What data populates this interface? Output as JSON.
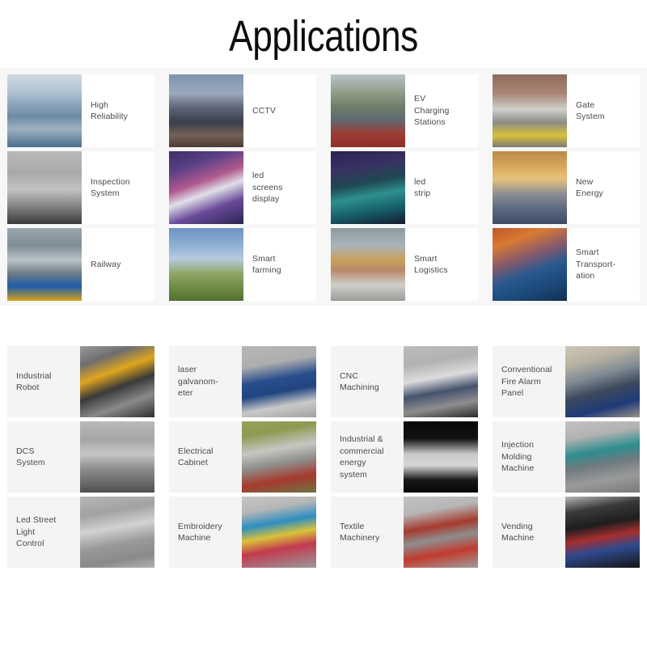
{
  "page": {
    "title": "Applications",
    "background_color": "#ffffff"
  },
  "section_primary": {
    "background_color": "#f7f7f7",
    "card_background": "#ffffff",
    "layout": "image-left-text-right",
    "label_color": "#4a4a4a",
    "cards": [
      {
        "label": "High\nReliability",
        "image": "turnstile-gates-station-photo"
      },
      {
        "label": "CCTV",
        "image": "city-street-traffic-night-camera-photo"
      },
      {
        "label": "EV\nCharging\nStations",
        "image": "electric-vehicle-charging-station-photo"
      },
      {
        "label": "Gate\nSystem",
        "image": "parking-barrier-gate-keep-left-photo"
      },
      {
        "label": "Inspection\nSystem",
        "image": "x-ray-baggage-scanner-photo"
      },
      {
        "label": "led\nscreens\ndisplay",
        "image": "times-square-led-billboards-photo"
      },
      {
        "label": "led\nstrip",
        "image": "modern-house-led-lighting-night-photo"
      },
      {
        "label": "New\nEnergy",
        "image": "wind-turbines-solar-panels-photo"
      },
      {
        "label": "Railway",
        "image": "high-speed-train-factory-photo"
      },
      {
        "label": "Smart\nfarming",
        "image": "greenhouse-crops-photo"
      },
      {
        "label": "Smart\nLogistics",
        "image": "warehouse-racking-agv-robots-photo"
      },
      {
        "label": "Smart\nTransport-\nation",
        "image": "truck-highway-light-trails-photo"
      }
    ]
  },
  "section_secondary": {
    "background_color": "#ffffff",
    "card_background": "#f4f4f4",
    "layout": "text-left-image-right",
    "label_color": "#4a4a4a",
    "cards": [
      {
        "label": "Industrial\nRobot",
        "image": "industrial-robot-arm-photo"
      },
      {
        "label": "laser\ngalvanom-\neter",
        "image": "laser-marking-machine-photo"
      },
      {
        "label": "CNC\nMachining",
        "image": "cnc-machining-center-photo"
      },
      {
        "label": "Conventional\nFire Alarm\nPanel",
        "image": "fire-alarm-control-panel-photo"
      },
      {
        "label": "DCS\nSystem",
        "image": "dcs-control-cabinets-room-photo"
      },
      {
        "label": "Electrical\nCabinet",
        "image": "outdoor-electrical-cabinet-photo"
      },
      {
        "label": "Industrial &\ncommercial\nenergy\nsystem",
        "image": "energy-storage-system-cabinet-photo"
      },
      {
        "label": "Injection\nMolding\nMachine",
        "image": "injection-molding-machine-photo"
      },
      {
        "label": "Led Street\nLight\nControl",
        "image": "led-street-light-housing-photo"
      },
      {
        "label": "Embroidery\nMachine",
        "image": "embroidery-winding-machine-photo"
      },
      {
        "label": "Textile\nMachinery",
        "image": "textile-machinery-photo"
      },
      {
        "label": "Vending\nMachine",
        "image": "vending-machines-photo"
      }
    ]
  }
}
